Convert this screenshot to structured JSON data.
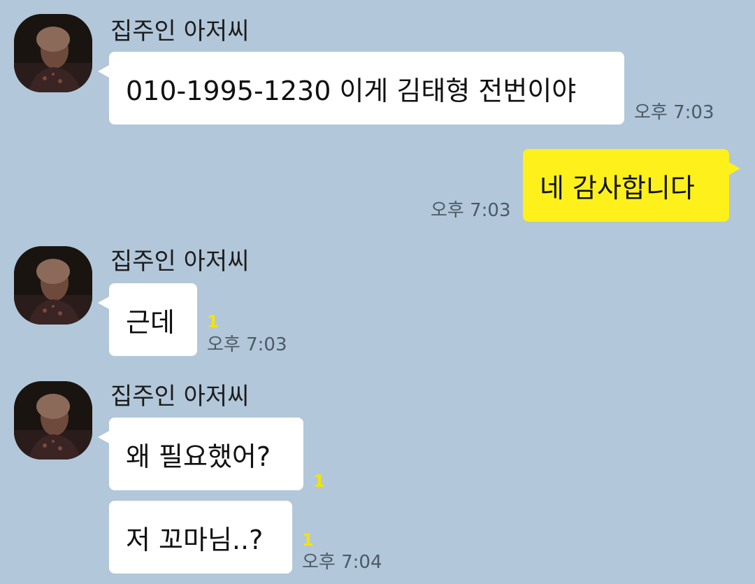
{
  "colors": {
    "background": "#b2c7d9",
    "incoming_bubble": "#ffffff",
    "outgoing_bubble": "#fef01b",
    "unread_count": "#f5e400"
  },
  "messages": [
    {
      "sender": "집주인 아저씨",
      "avatar": "profile-photo-icon",
      "text": "010-1995-1230 이게 김태형 전번이야",
      "time": "오후 7:03"
    },
    {
      "direction": "outgoing",
      "text": "네 감사합니다",
      "time": "오후 7:03"
    },
    {
      "sender": "집주인 아저씨",
      "avatar": "profile-photo-icon",
      "text": "근데",
      "unread": "1",
      "time": "오후 7:03"
    },
    {
      "sender": "집주인 아저씨",
      "avatar": "profile-photo-icon",
      "text": "왜 필요했어?",
      "unread": "1"
    },
    {
      "text": "저 꼬마님..?",
      "unread": "1",
      "time": "오후 7:04"
    }
  ]
}
